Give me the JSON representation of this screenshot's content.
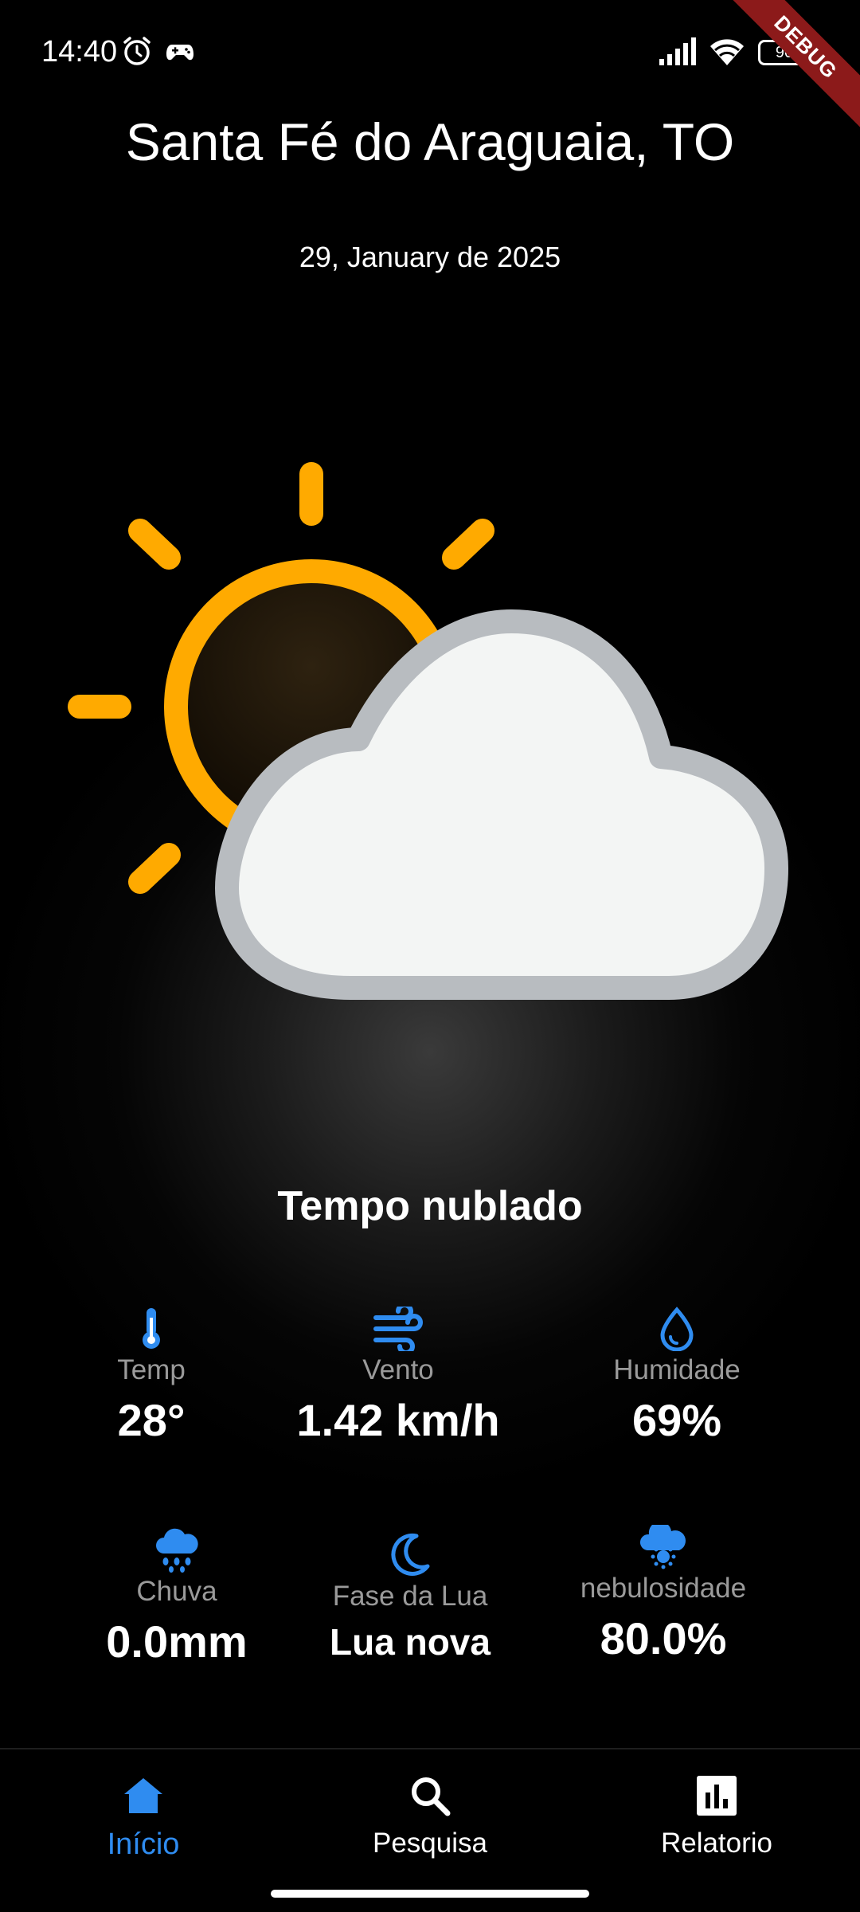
{
  "status_bar": {
    "time": "14:40",
    "battery": "90",
    "debug_label": "DEBUG",
    "icons": [
      "alarm-icon",
      "gamepad-icon",
      "signal-icon",
      "wifi-icon",
      "battery-icon"
    ]
  },
  "header": {
    "city": "Santa Fé do Araguaia, TO",
    "date": "29, January de 2025"
  },
  "weather": {
    "icon": "partly-cloudy-icon",
    "condition": "Tempo nublado"
  },
  "stats": {
    "temp": {
      "label": "Temp",
      "value": "28°",
      "icon": "thermometer-icon"
    },
    "wind": {
      "label": "Vento",
      "value": "1.42 km/h",
      "icon": "wind-icon"
    },
    "humidity": {
      "label": "Humidade",
      "value": "69%",
      "icon": "water-drop-icon"
    },
    "rain": {
      "label": "Chuva",
      "value": "0.0mm",
      "icon": "rain-cloud-icon"
    },
    "moon": {
      "label": "Fase da Lua",
      "value": "Lua nova",
      "icon": "crescent-moon-icon"
    },
    "clouds": {
      "label": "nebulosidade",
      "value": "80.0%",
      "icon": "cloud-sun-icon"
    }
  },
  "nav": {
    "items": [
      {
        "label": "Início",
        "icon": "home-icon",
        "active": true
      },
      {
        "label": "Pesquisa",
        "icon": "search-icon",
        "active": false
      },
      {
        "label": "Relatorio",
        "icon": "bar-chart-icon",
        "active": false
      }
    ]
  },
  "colors": {
    "accent": "#2f8cf0",
    "sun": "#ffaa00",
    "cloud_fill": "#f3f5f4",
    "cloud_stroke": "#b8bcc0",
    "debug": "#8c1a1a"
  }
}
